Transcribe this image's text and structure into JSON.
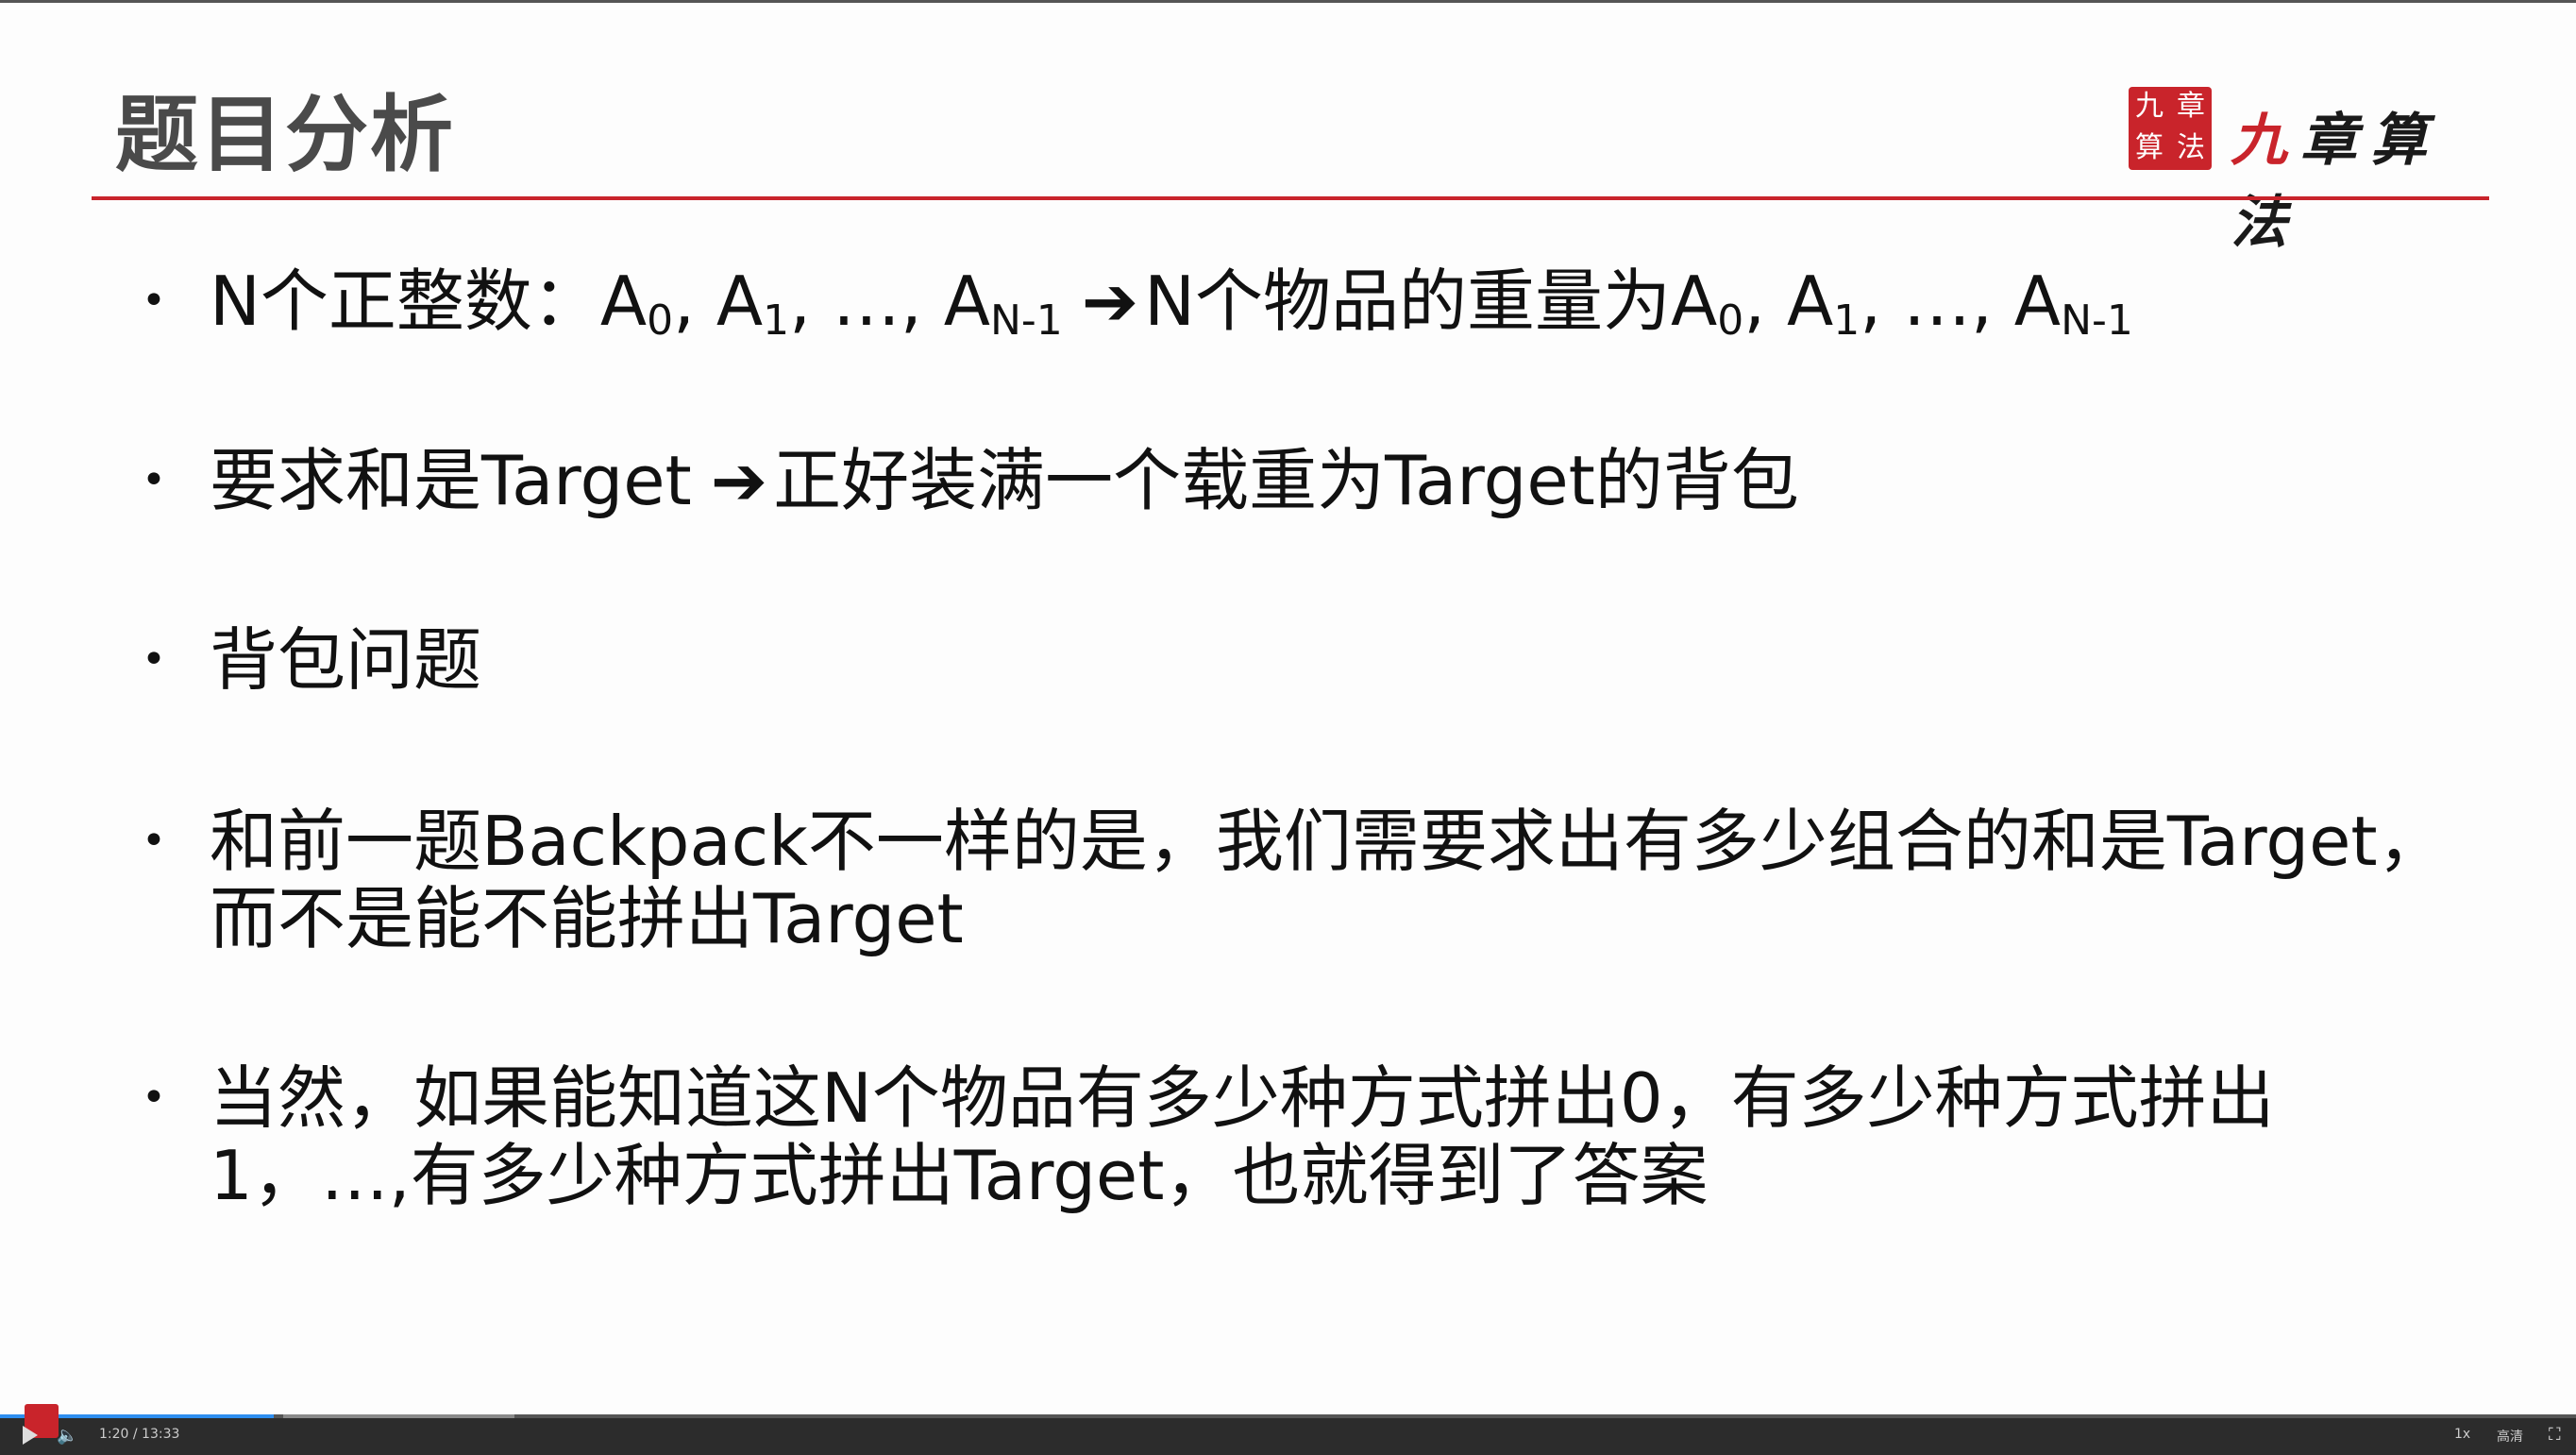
{
  "slide": {
    "title": "题目分析",
    "logo": {
      "seal_chars": [
        "九",
        "章",
        "算",
        "法"
      ],
      "text": "九章算法"
    },
    "bullets": [
      {
        "parts": [
          "N个正整数：A",
          "0",
          ", A",
          "1",
          ", …, A",
          "N-1"
        ],
        "arrow": "➔",
        "tail_parts": [
          "N个物品的重量为A",
          "0",
          ", A",
          "1",
          ", …, A",
          "N-1"
        ]
      },
      {
        "text": "要求和是Target",
        "arrow": "➔",
        "tail": "正好装满一个载重为Target的背包"
      },
      {
        "text": "背包问题"
      },
      {
        "line1": "和前一题Backpack不一样的是，我们需要求出有多少组合的和是Target，",
        "line2": "而不是能不能拼出Target"
      },
      {
        "line1": "当然，如果能知道这N个物品有多少种方式拼出0，有多少种方式拼出",
        "line2": "1，…,有多少种方式拼出Target，也就得到了答案"
      }
    ]
  },
  "player": {
    "time": "1:20 / 13:33",
    "speed": "1x",
    "quality": "高清",
    "progress_fraction": 0.1
  },
  "colors": {
    "accent": "#c9242b",
    "title": "#4a4a4a",
    "progress": "#2e8ef0"
  }
}
